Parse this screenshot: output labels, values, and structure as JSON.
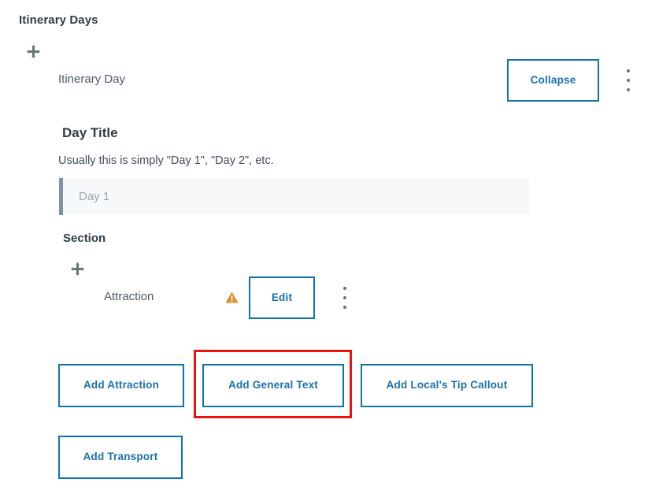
{
  "page": {
    "heading": "Itinerary Days",
    "background_color": "#ffffff"
  },
  "itinerary_day": {
    "label": "Itinerary Day",
    "drag_handle_icon": "move-icon",
    "collapse_label": "Collapse",
    "kebab_icon": "more-vertical-icon"
  },
  "day_title": {
    "heading": "Day Title",
    "helper_text": "Usually this is simply \"Day 1\", \"Day 2\", etc.",
    "input_value": "",
    "input_placeholder": "Day 1",
    "accent_bar_color": "#7a93a8",
    "field_background": "#f6f8fa"
  },
  "section": {
    "heading": "Section",
    "item": {
      "label": "Attraction",
      "drag_handle_icon": "move-icon",
      "warning_icon": "warning-triangle-icon",
      "warning_color": "#e0912a",
      "edit_label": "Edit",
      "kebab_icon": "more-vertical-icon"
    }
  },
  "actions": {
    "add_attraction": "Add Attraction",
    "add_general_text": "Add General Text",
    "add_tip_callout": "Add Local's Tip Callout",
    "add_transport": "Add Transport"
  },
  "colors": {
    "accent_blue": "#1073b0",
    "button_text_blue": "#1a6fb0",
    "highlight_red": "#ee1111",
    "warning_orange": "#e0912a",
    "heading_text": "#2e3d46"
  },
  "highlight": {
    "target": "add_general_text",
    "color": "#ee1111"
  }
}
